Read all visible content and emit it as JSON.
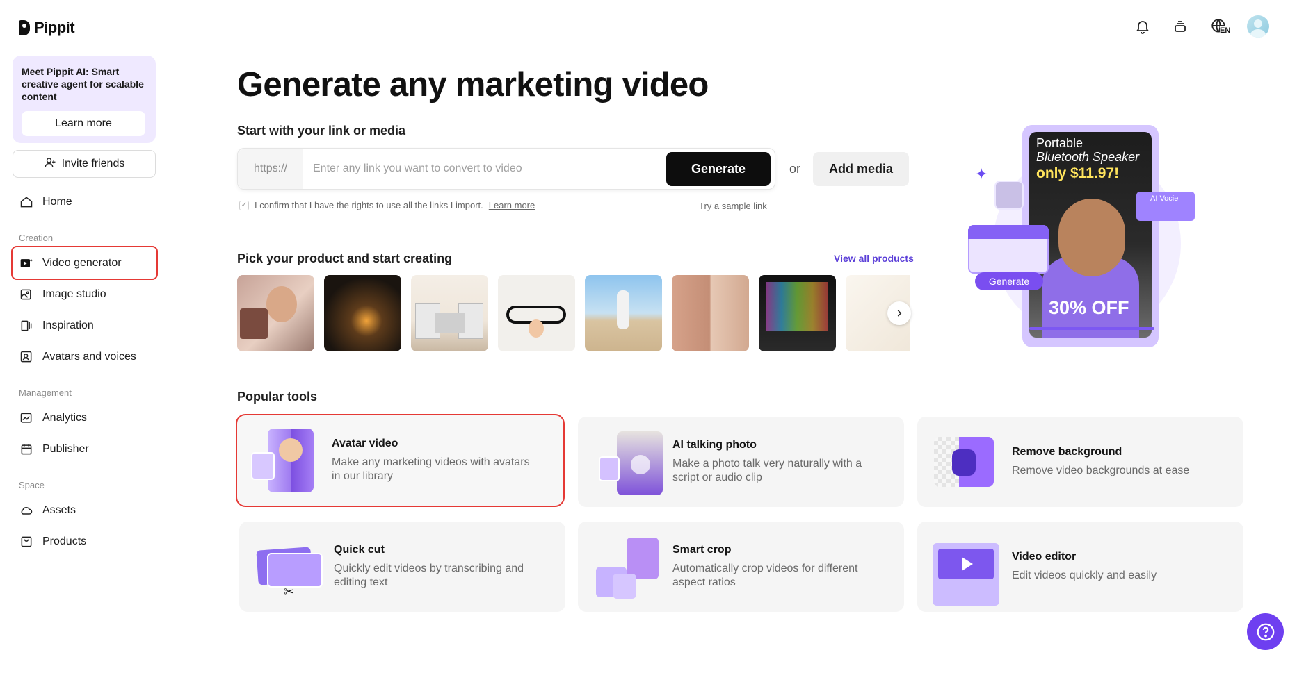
{
  "app": {
    "name": "Pippit"
  },
  "topbar": {
    "icons": [
      "bell-icon",
      "stack-icon",
      "globe-language-icon",
      "user-avatar"
    ],
    "language_badge": "EN"
  },
  "sidebar": {
    "promo": {
      "text": "Meet Pippit AI: Smart creative agent for scalable content",
      "button": "Learn more"
    },
    "invite_label": "Invite friends",
    "home_label": "Home",
    "sections": {
      "creation": "Creation",
      "management": "Management",
      "space": "Space"
    },
    "items": {
      "video_generator": "Video generator",
      "image_studio": "Image studio",
      "inspiration": "Inspiration",
      "avatars_voices": "Avatars and voices",
      "analytics": "Analytics",
      "publisher": "Publisher",
      "assets": "Assets",
      "products": "Products"
    }
  },
  "main": {
    "title": "Generate any marketing video",
    "link_section_label": "Start with your link or media",
    "link_prefix": "https://",
    "link_placeholder": "Enter any link you want to convert to video",
    "generate_label": "Generate",
    "or_label": "or",
    "add_media_label": "Add media",
    "confirm_text": "I confirm that I have the rights to use all the links I import.",
    "confirm_link": "Learn more",
    "sample_link": "Try a sample link",
    "pick_label": "Pick your product and start creating",
    "view_all": "View all products",
    "popular_label": "Popular tools",
    "tools": [
      {
        "title": "Avatar video",
        "desc": "Make any marketing videos with avatars in our library"
      },
      {
        "title": "AI talking photo",
        "desc": "Make a photo talk very naturally with a script or audio clip"
      },
      {
        "title": "Remove background",
        "desc": "Remove video backgrounds at ease"
      },
      {
        "title": "Quick cut",
        "desc": "Quickly edit videos by transcribing and editing text"
      },
      {
        "title": "Smart crop",
        "desc": "Automatically crop videos for different aspect ratios"
      },
      {
        "title": "Video editor",
        "desc": "Edit videos quickly and easily"
      }
    ]
  },
  "hero": {
    "line1": "Portable",
    "line2": "Bluetooth Speaker",
    "price": "only $11.97!",
    "discount": "30% OFF",
    "generate": "Generate",
    "ai_voice": "AI Vocie"
  },
  "colors": {
    "accent": "#6e3ff0",
    "highlight_border": "#e53935",
    "promo_bg": "#efe9ff"
  }
}
